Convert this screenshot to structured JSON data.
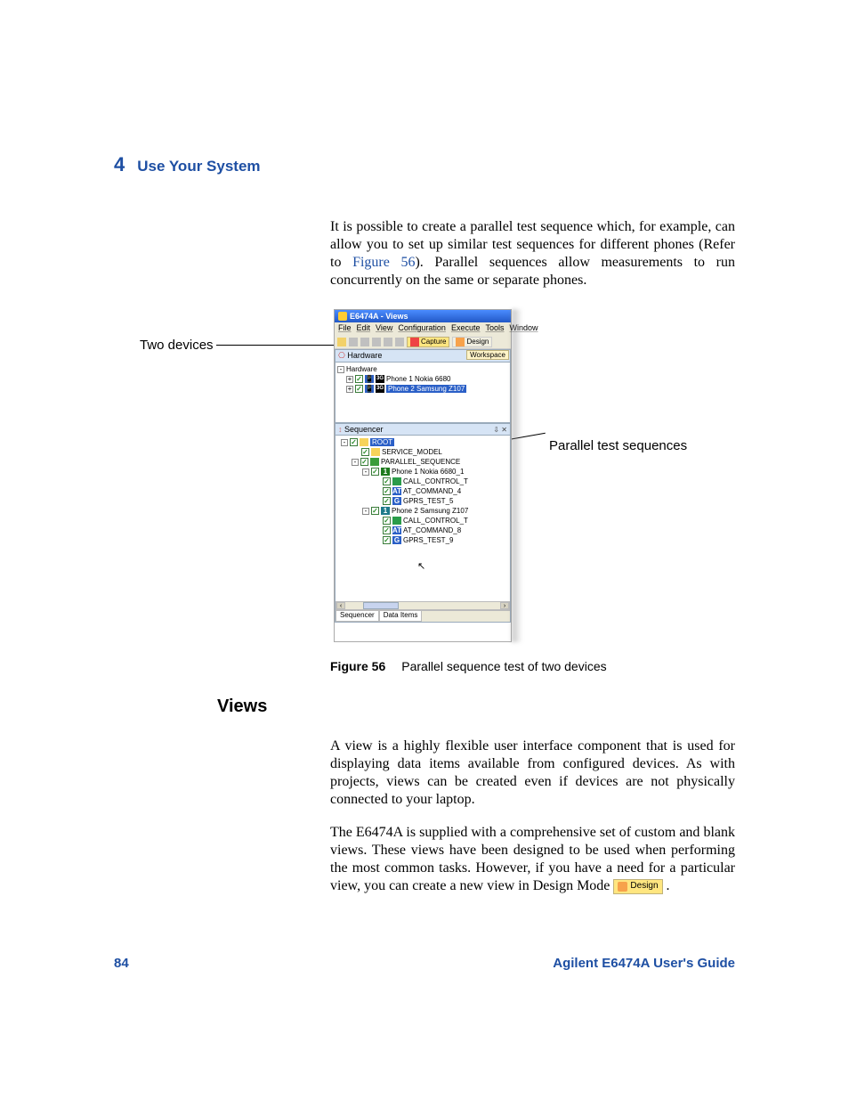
{
  "header": {
    "chapter_number": "4",
    "chapter_title": "Use Your System"
  },
  "para1_a": "It is possible to create a parallel test sequence which, for example, can allow you to set up similar test sequences for different phones (Refer to ",
  "para1_link": "Figure 56",
  "para1_b": "). Parallel sequences allow measurements to run concurrently on the same or separate phones.",
  "callouts": {
    "left": "Two devices",
    "right": "Parallel test sequences"
  },
  "app": {
    "title": "E6474A - Views",
    "menus": [
      "File",
      "Edit",
      "View",
      "Configuration",
      "Execute",
      "Tools",
      "Window"
    ],
    "toolbar": {
      "capture": "Capture",
      "design": "Design"
    },
    "workspace_tab": "Workspace",
    "hardware": {
      "title": "Hardware",
      "pins": "⇩ ✕",
      "root": "Hardware",
      "items": [
        {
          "tag": "3G",
          "label": "Phone 1 Nokia 6680",
          "sel": false
        },
        {
          "tag": "3G",
          "label": "Phone 2 Samsung Z107",
          "sel": true
        }
      ]
    },
    "sequencer": {
      "title": "Sequencer",
      "pins": "⇩ ✕",
      "tree": [
        {
          "ind": 4,
          "exp": "-",
          "chk": true,
          "ico": "#f7d35a",
          "txt": "ROOT",
          "sel": true
        },
        {
          "ind": 16,
          "exp": "",
          "chk": true,
          "ico": "#f7d35a",
          "txt": "SERVICE_MODEL"
        },
        {
          "ind": 16,
          "exp": "-",
          "chk": true,
          "ico": "#3a9c3a",
          "txt": "PARALLEL_SEQUENCE"
        },
        {
          "ind": 28,
          "exp": "-",
          "chk": true,
          "ico": "#1e7a1e",
          "tag": "1",
          "txt": "Phone 1 Nokia 6680_1"
        },
        {
          "ind": 40,
          "exp": "",
          "chk": true,
          "ico": "#2a9c4a",
          "txt": "CALL_CONTROL_T"
        },
        {
          "ind": 40,
          "exp": "",
          "chk": true,
          "ico": "#2a5fc7",
          "tag": "AT",
          "txt": "AT_COMMAND_4"
        },
        {
          "ind": 40,
          "exp": "",
          "chk": true,
          "ico": "#2a5fc7",
          "tag": "G",
          "txt": "GPRS_TEST_5"
        },
        {
          "ind": 28,
          "exp": "-",
          "chk": true,
          "ico": "#1e7a8a",
          "tag": "1",
          "txt": "Phone 2 Samsung Z107"
        },
        {
          "ind": 40,
          "exp": "",
          "chk": true,
          "ico": "#2a9c4a",
          "txt": "CALL_CONTROL_T"
        },
        {
          "ind": 40,
          "exp": "",
          "chk": true,
          "ico": "#2a5fc7",
          "tag": "AT",
          "txt": "AT_COMMAND_8"
        },
        {
          "ind": 40,
          "exp": "",
          "chk": true,
          "ico": "#2a5fc7",
          "tag": "G",
          "txt": "GPRS_TEST_9"
        }
      ],
      "tabs": [
        "Sequencer",
        "Data Items"
      ]
    }
  },
  "figure": {
    "label": "Figure 56",
    "caption": "Parallel sequence test of two devices"
  },
  "views_heading": "Views",
  "para2": "A view is a highly flexible user interface component that is used for displaying data items available from configured devices. As with projects, views can be created even if devices are not physically connected to your laptop.",
  "para3_a": "The E6474A is supplied with a comprehensive set of custom and blank views. These views have been designed to be used when performing the most common tasks. However, if you have a need for a particular view, you can create a new view in Design Mode ",
  "para3_b": " .",
  "design_inline": "Design",
  "footer": {
    "page": "84",
    "doc": "Agilent E6474A User's Guide"
  }
}
